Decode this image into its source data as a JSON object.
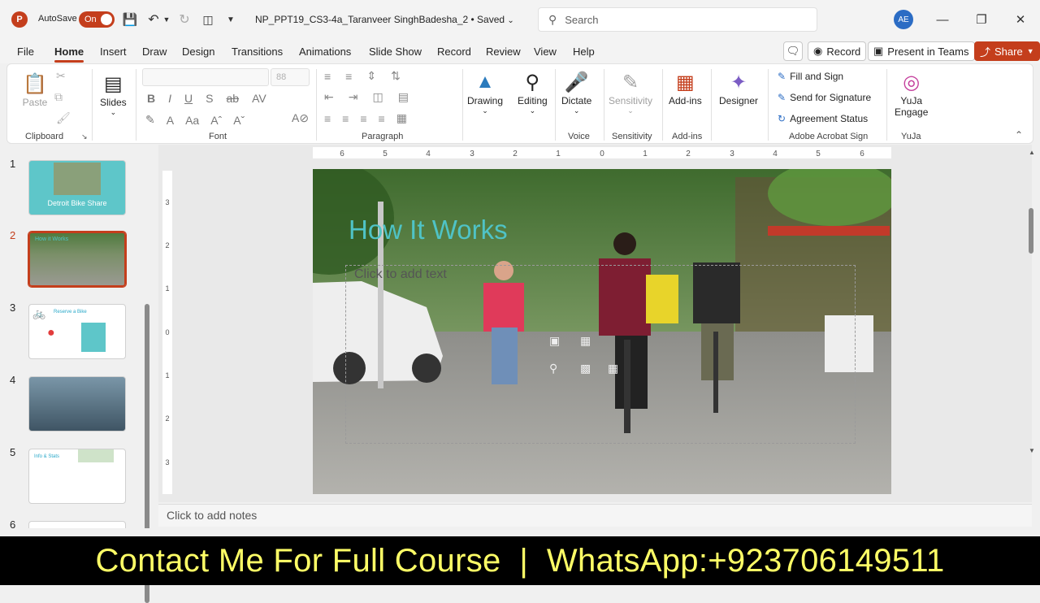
{
  "titlebar": {
    "autosave_label": "AutoSave",
    "autosave_state": "On",
    "doc_title": "NP_PPT19_CS3-4a_Taranveer SinghBadesha_2 • Saved",
    "search_placeholder": "Search",
    "avatar_initials": "AE"
  },
  "menu": {
    "items": [
      "File",
      "Home",
      "Insert",
      "Draw",
      "Design",
      "Transitions",
      "Animations",
      "Slide Show",
      "Record",
      "Review",
      "View",
      "Help"
    ],
    "active": "Home",
    "record_label": "Record",
    "present_label": "Present in Teams",
    "share_label": "Share"
  },
  "ribbon": {
    "groups": {
      "clipboard": "Clipboard",
      "font": "Font",
      "paragraph": "Paragraph",
      "voice": "Voice",
      "sensitivity": "Sensitivity",
      "addins": "Add-ins",
      "adobe": "Adobe Acrobat Sign",
      "yuja": "YuJa"
    },
    "paste_label": "Paste",
    "slides_label": "Slides",
    "font_size": "88",
    "drawing_label": "Drawing",
    "editing_label": "Editing",
    "dictate_label": "Dictate",
    "sensitivity_label": "Sensitivity",
    "addins_label": "Add-ins",
    "designer_label": "Designer",
    "fill_sign_label": "Fill and Sign",
    "send_signature_label": "Send for Signature",
    "agreement_status_label": "Agreement Status",
    "yuja_label_1": "YuJa",
    "yuja_label_2": "Engage"
  },
  "thumbnails": [
    {
      "num": "1",
      "caption": "Detroit Bike Share"
    },
    {
      "num": "2",
      "caption": "How it Works"
    },
    {
      "num": "3",
      "caption": "Reserve a Bike"
    },
    {
      "num": "4",
      "caption": ""
    },
    {
      "num": "5",
      "caption": "Info & Stats"
    },
    {
      "num": "6",
      "caption": ""
    }
  ],
  "slide": {
    "title": "How It Works",
    "placeholder": "Click to add text"
  },
  "notes_placeholder": "Click to add notes",
  "banner": "Contact Me For Full Course  |  WhatsApp:+923706149511",
  "colors": {
    "accent": "#c43e1c",
    "title_teal": "#4fc3c6",
    "banner_text": "#ffff66"
  }
}
